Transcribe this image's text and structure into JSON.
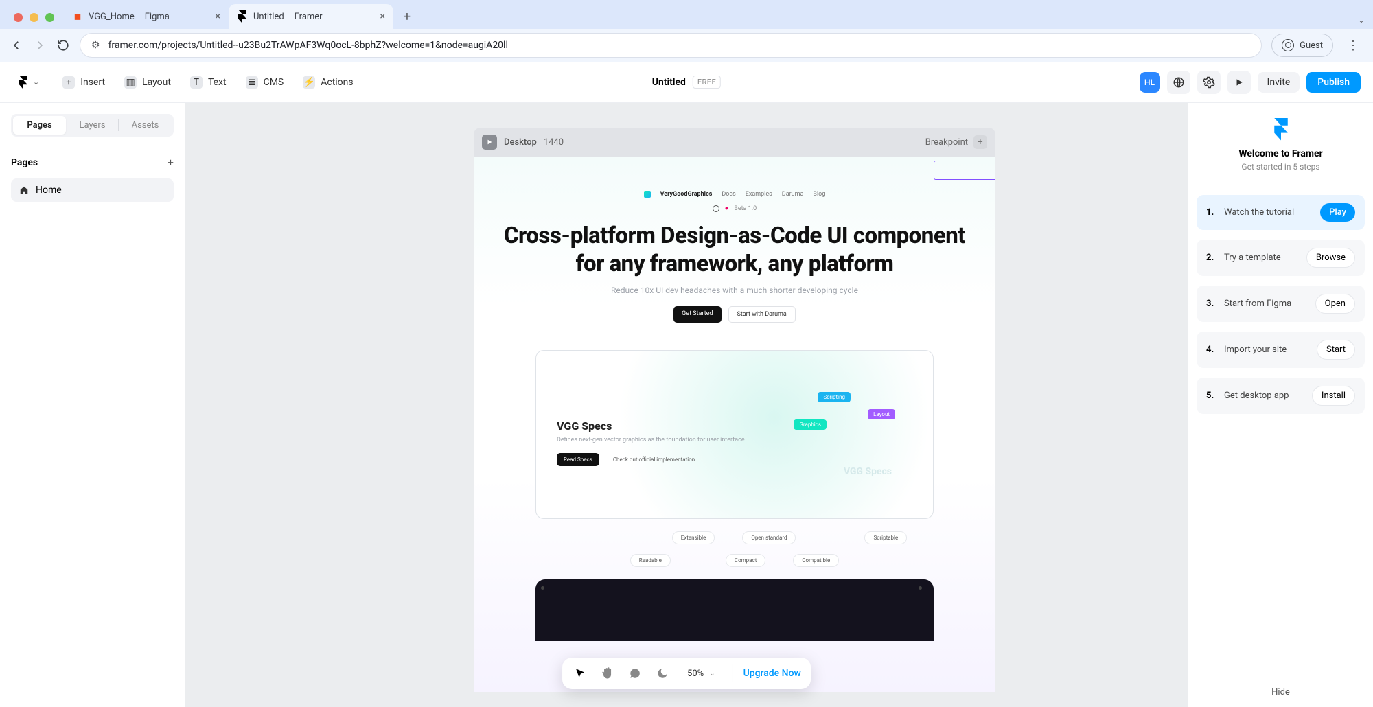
{
  "browser": {
    "tabs": [
      {
        "title": "VGG_Home – Figma"
      },
      {
        "title": "Untitled – Framer"
      }
    ],
    "url": "framer.com/projects/Untitled--u23Bu2TrAWpAF3Wq0ocL-8bphZ?welcome=1&node=augiA20ll",
    "guest": "Guest"
  },
  "toolbar": {
    "insert": "Insert",
    "layout": "Layout",
    "text": "Text",
    "cms": "CMS",
    "actions": "Actions"
  },
  "doc": {
    "title": "Untitled",
    "badge": "FREE"
  },
  "actions": {
    "invite": "Invite",
    "publish": "Publish",
    "avatar": "HL"
  },
  "sidebar": {
    "tabs": [
      "Pages",
      "Layers",
      "Assets"
    ],
    "pages_header": "Pages",
    "pages": [
      "Home"
    ]
  },
  "canvas": {
    "frame_label": "Desktop",
    "frame_width": "1440",
    "breakpoint": "Breakpoint"
  },
  "site": {
    "brand": "VeryGoodGraphics",
    "nav": [
      "Docs",
      "Examples",
      "Daruma",
      "Blog"
    ],
    "beta_label": "Beta 1.0",
    "hero_title_l1": "Cross-platform Design-as-Code UI component",
    "hero_title_l2": "for any framework, any platform",
    "hero_sub": "Reduce 10x UI dev headaches with a much shorter developing cycle",
    "btn_get_started": "Get Started",
    "btn_daruma": "Start with Daruma",
    "specs_title": "VGG Specs",
    "specs_sub": "Defines next-gen vector graphics as the foundation for user interface",
    "specs_read": "Read Specs",
    "specs_check": "Check out official implementation",
    "tag_script": "Scripting",
    "tag_graphic": "Graphics",
    "tag_layout": "Layout",
    "ghost": "VGG Specs",
    "pills": [
      "Extensible",
      "Open standard",
      "Scriptable",
      "Readable",
      "Compact",
      "Compatible"
    ]
  },
  "welcome": {
    "title": "Welcome to Framer",
    "sub": "Get started in 5 steps",
    "steps": [
      {
        "n": "1.",
        "label": "Watch the tutorial",
        "action": "Play"
      },
      {
        "n": "2.",
        "label": "Try a template",
        "action": "Browse"
      },
      {
        "n": "3.",
        "label": "Start from Figma",
        "action": "Open"
      },
      {
        "n": "4.",
        "label": "Import your site",
        "action": "Start"
      },
      {
        "n": "5.",
        "label": "Get desktop app",
        "action": "Install"
      }
    ],
    "hide": "Hide"
  },
  "floatbar": {
    "zoom": "50%",
    "upgrade": "Upgrade Now"
  }
}
